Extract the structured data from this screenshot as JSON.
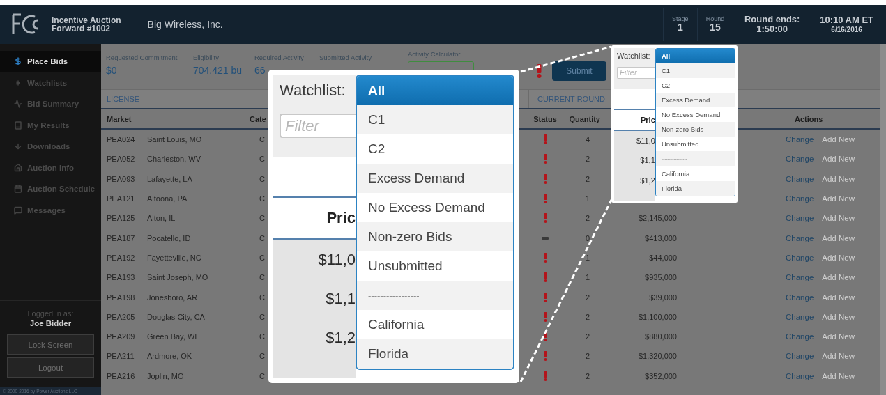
{
  "header": {
    "title_line1": "Incentive Auction",
    "title_line2": "Forward #1002",
    "company": "Big Wireless, Inc.",
    "stats": [
      {
        "label": "Stage",
        "value": "1"
      },
      {
        "label": "Round",
        "value": "15"
      }
    ],
    "round_ends": {
      "label": "Round ends:",
      "value": "1:50:00"
    },
    "clock": {
      "time": "10:10 AM ET",
      "date": "6/16/2016"
    }
  },
  "sidebar": {
    "items": [
      {
        "label": "Place Bids",
        "selected": true
      },
      {
        "label": "Watchlists",
        "selected": false
      },
      {
        "label": "Bid Summary",
        "selected": false
      },
      {
        "label": "My Results",
        "selected": false
      },
      {
        "label": "Downloads",
        "selected": false
      },
      {
        "label": "Auction Info",
        "selected": false
      },
      {
        "label": "Auction Schedule",
        "selected": false
      },
      {
        "label": "Messages",
        "selected": false
      }
    ],
    "login_label": "Logged in as:",
    "user": "Joe Bidder",
    "buttons": [
      "Lock Screen",
      "Logout"
    ],
    "footer": "© 2000-2016 by Power Auctions LLC"
  },
  "summary": {
    "fields": [
      {
        "label": "Requested Commitment",
        "value": "$0"
      },
      {
        "label": "Eligibility",
        "value": "704,421 bu"
      },
      {
        "label": "Required Activity",
        "value": "66"
      },
      {
        "label": "Submitted Activity"
      }
    ],
    "calculator_label": "Activity Calculator",
    "alert": true,
    "submit": "Submit"
  },
  "table": {
    "sections": [
      "LICENSE",
      "CURRENT ROUND"
    ],
    "columns": {
      "market": "Market",
      "category": "Cate",
      "status": "Status",
      "quantity": "Quantity",
      "actions": "Actions"
    },
    "rows": [
      {
        "code": "PEA024",
        "city": "Saint Louis, MO",
        "category": "C",
        "kind": "warning",
        "quantity": "4",
        "actions": [
          {
            "label": "Change",
            "disabled": false
          },
          {
            "label": "Add New",
            "disabled": true
          }
        ]
      },
      {
        "code": "PEA052",
        "city": "Charleston, WV",
        "category": "C",
        "kind": "warning",
        "quantity": "2",
        "actions": [
          {
            "label": "Change",
            "disabled": false
          },
          {
            "label": "Add New",
            "disabled": true
          }
        ]
      },
      {
        "code": "PEA093",
        "city": "Lafayette, LA",
        "category": "C",
        "kind": "warning",
        "quantity": "2",
        "actions": [
          {
            "label": "Change",
            "disabled": false
          },
          {
            "label": "Add New",
            "disabled": true
          }
        ]
      },
      {
        "code": "PEA121",
        "city": "Altoona, PA",
        "category": "C",
        "kind": "warning",
        "quantity": "1",
        "actions": [
          {
            "label": "Change",
            "disabled": false
          },
          {
            "label": "Add New",
            "disabled": true
          }
        ]
      },
      {
        "code": "PEA125",
        "city": "Alton, IL",
        "category": "C",
        "kind": "warning",
        "quantity": "2",
        "price": "$2,145,000",
        "actions": [
          {
            "label": "Change",
            "disabled": false
          },
          {
            "label": "Add New",
            "disabled": true
          }
        ]
      },
      {
        "code": "PEA187",
        "city": "Pocatello, ID",
        "category": "C",
        "kind": "none",
        "quantity": "0",
        "price": "$413,000",
        "actions": [
          {
            "label": "Change",
            "disabled": false
          },
          {
            "label": "Add New",
            "disabled": true
          }
        ]
      },
      {
        "code": "PEA192",
        "city": "Fayetteville, NC",
        "category": "C",
        "kind": "warning",
        "quantity": "1",
        "price": "$44,000",
        "actions": [
          {
            "label": "Change",
            "disabled": false
          },
          {
            "label": "Add New",
            "disabled": true
          }
        ]
      },
      {
        "code": "PEA193",
        "city": "Saint Joseph, MO",
        "category": "C",
        "kind": "warning",
        "quantity": "1",
        "price": "$935,000",
        "actions": [
          {
            "label": "Change",
            "disabled": false
          },
          {
            "label": "Add New",
            "disabled": true
          }
        ]
      },
      {
        "code": "PEA198",
        "city": "Jonesboro, AR",
        "category": "C",
        "kind": "warning",
        "quantity": "2",
        "price": "$39,000",
        "actions": [
          {
            "label": "Change",
            "disabled": false
          },
          {
            "label": "Add New",
            "disabled": true
          }
        ]
      },
      {
        "code": "PEA205",
        "city": "Douglas City, CA",
        "category": "C",
        "kind": "warning",
        "quantity": "2",
        "price": "$1,100,000",
        "actions": [
          {
            "label": "Change",
            "disabled": false
          },
          {
            "label": "Add New",
            "disabled": true
          }
        ]
      },
      {
        "code": "PEA209",
        "city": "Green Bay, WI",
        "category": "C",
        "kind": "warning",
        "quantity": "2",
        "price": "$880,000",
        "actions": [
          {
            "label": "Change",
            "disabled": false
          },
          {
            "label": "Add New",
            "disabled": true
          }
        ]
      },
      {
        "code": "PEA211",
        "city": "Ardmore, OK",
        "category": "C",
        "kind": "warning",
        "quantity": "2",
        "price": "$1,320,000",
        "actions": [
          {
            "label": "Change",
            "disabled": false
          },
          {
            "label": "Add New",
            "disabled": true
          }
        ]
      },
      {
        "code": "PEA216",
        "city": "Joplin, MO",
        "category": "C",
        "kind": "warning",
        "quantity": "2",
        "price": "$352,000",
        "actions": [
          {
            "label": "Change",
            "disabled": false
          },
          {
            "label": "Add New",
            "disabled": true
          }
        ]
      }
    ]
  },
  "callouts": [
    {
      "label": "Watchlist:",
      "filter_placeholder": "Filter",
      "price_header": "Pric",
      "prices": [
        "$11,0",
        "$1,1",
        "$1,2"
      ],
      "options": [
        {
          "label": "All",
          "kind": "option",
          "selected": true
        },
        {
          "label": "C1",
          "kind": "option",
          "selected": false
        },
        {
          "label": "C2",
          "kind": "option",
          "selected": false
        },
        {
          "label": "Excess Demand",
          "kind": "option",
          "selected": false
        },
        {
          "label": "No Excess Demand",
          "kind": "option",
          "selected": false
        },
        {
          "label": "Non-zero Bids",
          "kind": "option",
          "selected": false
        },
        {
          "label": "Unsubmitted",
          "kind": "option",
          "selected": false
        },
        {
          "label": "-----------------",
          "kind": "separator",
          "selected": false
        },
        {
          "label": "California",
          "kind": "option",
          "selected": false
        },
        {
          "label": "Florida",
          "kind": "option",
          "selected": false
        }
      ]
    },
    {
      "label": "Watchlist:",
      "filter_placeholder": "Filter",
      "price_header": "Pric",
      "prices": [
        "$11,0",
        "$1,1",
        "$1,2"
      ],
      "options": [
        {
          "label": "All",
          "kind": "option",
          "selected": true
        },
        {
          "label": "C1",
          "kind": "option",
          "selected": false
        },
        {
          "label": "C2",
          "kind": "option",
          "selected": false
        },
        {
          "label": "Excess Demand",
          "kind": "option",
          "selected": false
        },
        {
          "label": "No Excess Demand",
          "kind": "option",
          "selected": false
        },
        {
          "label": "Non-zero Bids",
          "kind": "option",
          "selected": false
        },
        {
          "label": "Unsubmitted",
          "kind": "option",
          "selected": false
        },
        {
          "label": "-----------------",
          "kind": "separator",
          "selected": false
        },
        {
          "label": "California",
          "kind": "option",
          "selected": false
        },
        {
          "label": "Florida",
          "kind": "option",
          "selected": false
        }
      ]
    }
  ]
}
